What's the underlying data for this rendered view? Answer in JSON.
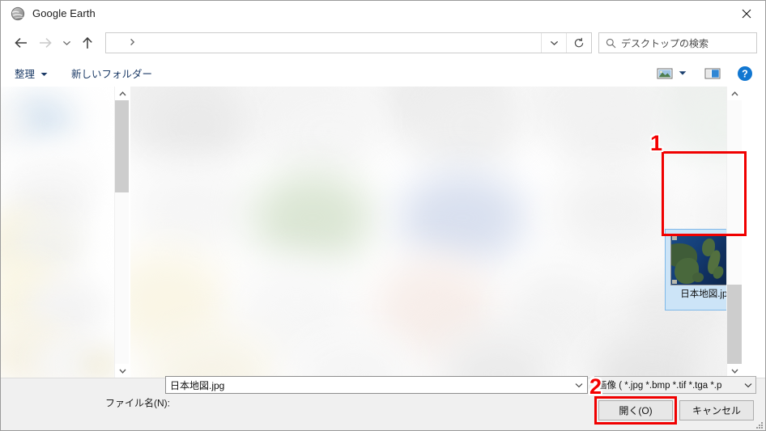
{
  "window": {
    "title": "Google Earth",
    "title_icon": "globe-icon",
    "close_icon": "close-icon"
  },
  "nav": {
    "back_icon": "arrow-left-icon",
    "forward_icon": "arrow-right-icon",
    "recent_icon": "chevron-down-icon",
    "up_icon": "arrow-up-icon",
    "address": {
      "location_icon": "desktop-monitor-icon",
      "separator_icon": "chevron-right-icon",
      "path": "",
      "dropdown_icon": "chevron-down-icon",
      "refresh_icon": "refresh-icon"
    },
    "search": {
      "icon": "search-icon",
      "placeholder": "デスクトップの検索"
    }
  },
  "toolbar": {
    "organize_label": "整理",
    "organize_caret_icon": "caret-down-icon",
    "new_folder_label": "新しいフォルダー",
    "view_icon": "view-thumbnail-icon",
    "view_caret_icon": "caret-down-icon",
    "preview_pane_icon": "preview-pane-icon",
    "help_icon": "help-circle-icon"
  },
  "panes": {
    "nav_pane_scroll": {
      "up_icon": "chevron-up-icon",
      "down_icon": "chevron-down-icon"
    },
    "file_pane_scroll": {
      "up_icon": "chevron-up-icon",
      "down_icon": "chevron-down-icon"
    },
    "selected_file": {
      "name": "日本地図.jpg",
      "thumbnail": "japan-satellite-map"
    }
  },
  "annotations": [
    {
      "number": "1",
      "target": "selected-file-thumbnail",
      "color": "#f40000"
    },
    {
      "number": "2",
      "target": "open-button",
      "color": "#f40000"
    }
  ],
  "annotation_numbers": {
    "first": "1",
    "second": "2"
  },
  "dialog": {
    "filename_label": "ファイル名(N):",
    "filename_value": "日本地図.jpg",
    "filename_caret_icon": "caret-down-icon",
    "filetype_value": "画像 ( *.jpg *.bmp *.tif *.tga *.p",
    "filetype_caret_icon": "caret-down-icon",
    "open_button": "開く(O)",
    "cancel_button": "キャンセル",
    "resize_grip_icon": "resize-grip-icon"
  },
  "colors": {
    "accent": "#1ea0f0",
    "selection": "#cce4f7",
    "annotation": "#f40000",
    "help_blue": "#1177d1"
  }
}
